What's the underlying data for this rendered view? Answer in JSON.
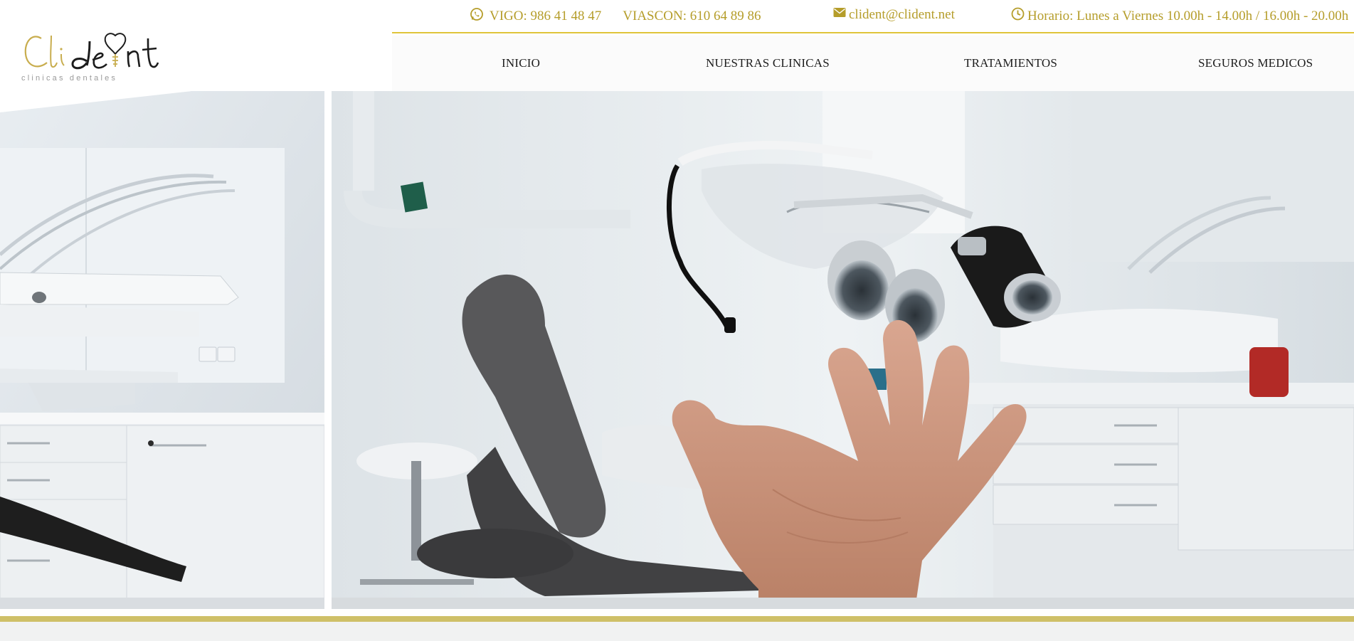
{
  "contact": {
    "vigo_label": "VIGO: 986 41 48 47",
    "viascon_label": "VIASCON: 610 64 89 86",
    "email": "clident@clident.net",
    "hours": "Horario: Lunes a Viernes 10.00h - 14.00h / 16.00h - 20.00h"
  },
  "brand": {
    "logo_alt": "Clident clinicas dentales",
    "logo_script": "Clident",
    "logo_tagline": "clinicas dentales",
    "accent": "#b59d2a",
    "gold_line": "#dfc43a",
    "band": "#cfc068"
  },
  "nav": {
    "items": [
      {
        "label": "INICIO"
      },
      {
        "label": "NUESTRAS CLINICAS"
      },
      {
        "label": "TRATAMIENTOS"
      },
      {
        "label": "SEGUROS MEDICOS"
      }
    ]
  },
  "icons": {
    "phone": "whatsapp-icon",
    "email": "envelope-icon",
    "hours": "clock-icon"
  }
}
